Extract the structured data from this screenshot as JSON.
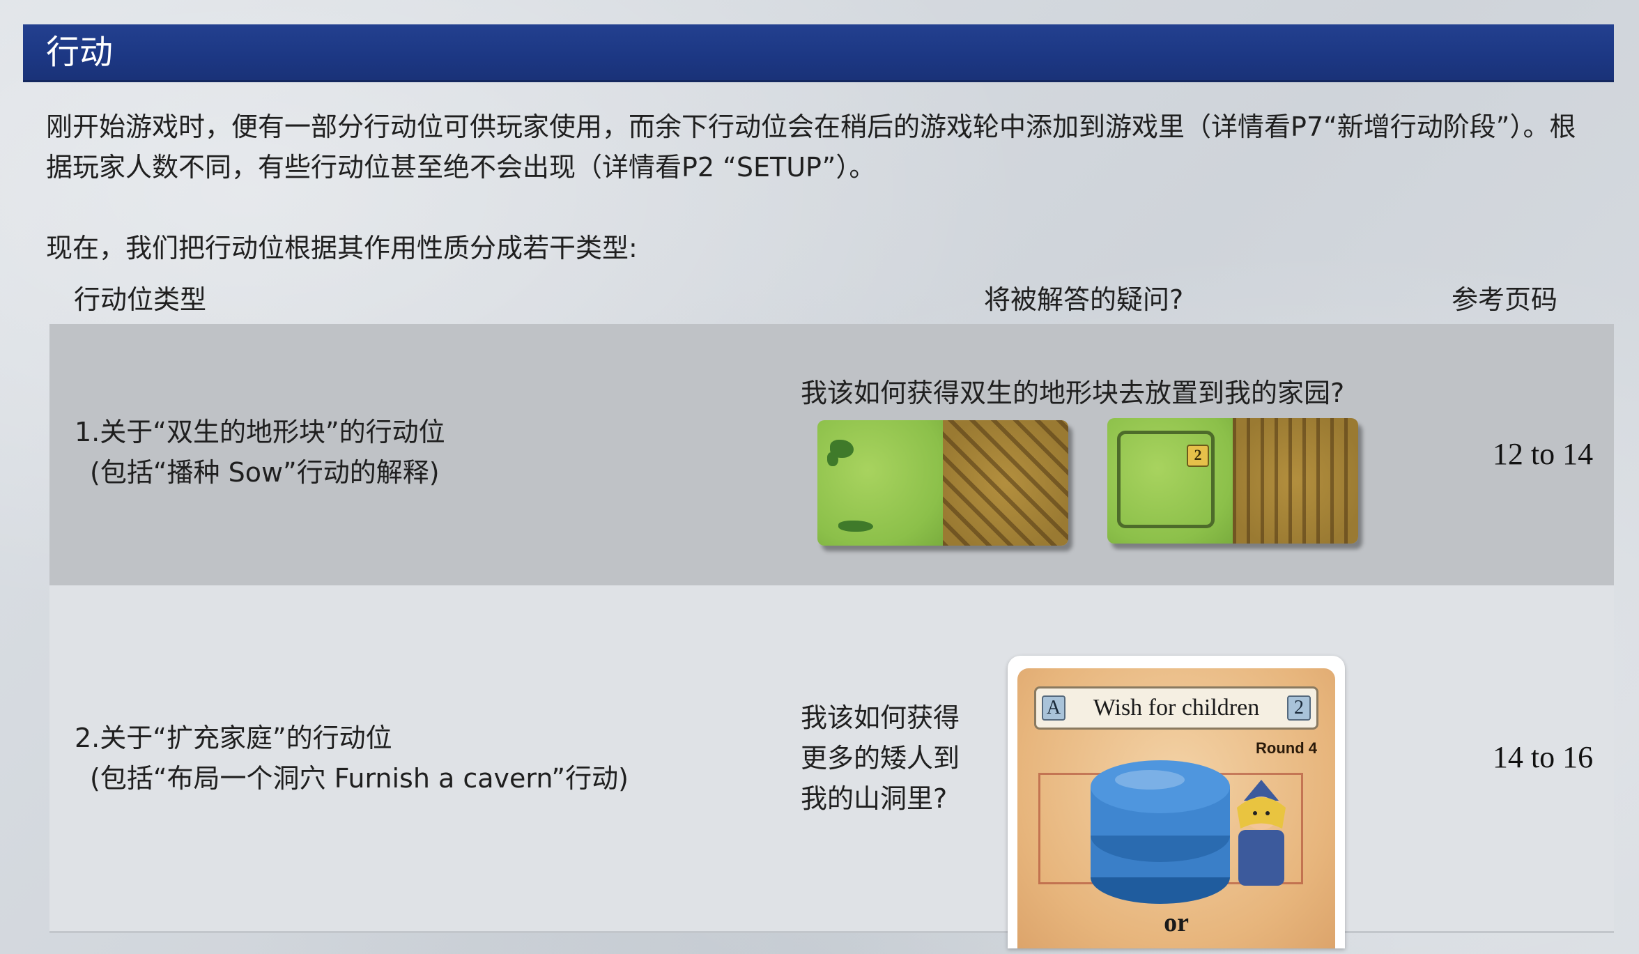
{
  "section": {
    "title": "行动"
  },
  "intro": {
    "paragraph1": "刚开始游戏时，便有一部分行动位可供玩家使用，而余下行动位会在稍后的游戏轮中添加到游戏里（详情看P7“新增行动阶段”）。根据玩家人数不同，有些行动位甚至绝不会出现（详情看P2 “SETUP”）。",
    "paragraph2": "现在，我们把行动位根据其作用性质分成若干类型:"
  },
  "table": {
    "headers": {
      "type": "行动位类型",
      "question": "将被解答的疑问?",
      "page": "参考页码"
    },
    "rows": [
      {
        "type_line1": "1.关于“双生的地形块”的行动位",
        "type_line2": "(包括“播种 Sow”行动的解释)",
        "question": "我该如何获得双生的地形块去放置到我的家园?",
        "page_ref": "12 to 14",
        "tiles": [
          {
            "left": "meadow",
            "right": "field"
          },
          {
            "left": "pasture",
            "right": "field",
            "badge": "2"
          }
        ]
      },
      {
        "type_line1": "2.关于“扩充家庭”的行动位",
        "type_line2": "(包括“布局一个洞穴 Furnish a cavern”行动)",
        "question": "我该如何获得更多的矮人到我的山洞里?",
        "page_ref": "14 to 16",
        "card": {
          "letter": "A",
          "title": "Wish for children",
          "count": "2",
          "round": "Round 4",
          "or": "or"
        }
      }
    ]
  },
  "colors": {
    "header_bar": "#1c3783",
    "row_dark": "#bfc2c6",
    "row_light": "#dfe2e6",
    "disc_blue": "#3a7fc8"
  }
}
